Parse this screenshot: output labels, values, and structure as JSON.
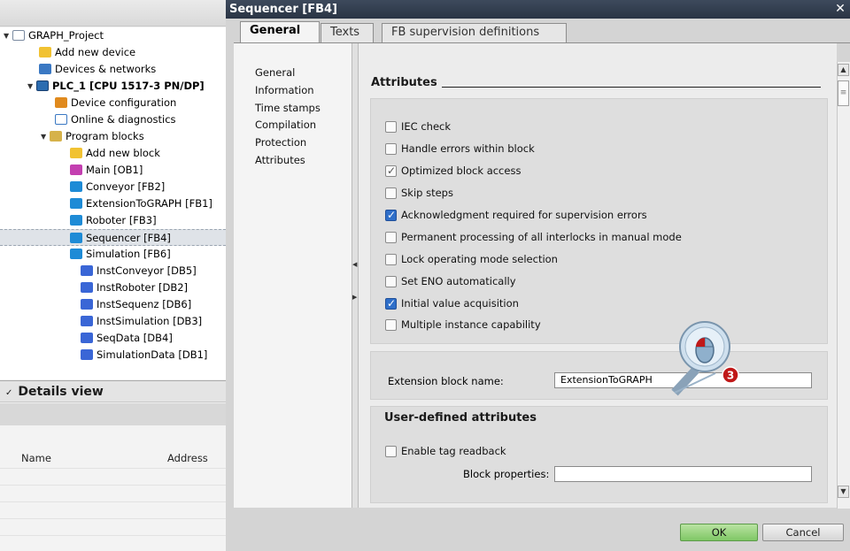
{
  "tree": {
    "items": [
      {
        "label": "GRAPH_Project",
        "icon": "project-icon"
      },
      {
        "label": "Add new device",
        "icon": "add-device-icon"
      },
      {
        "label": "Devices & networks",
        "icon": "network-icon"
      },
      {
        "label": "PLC_1 [CPU 1517-3 PN/DP]",
        "icon": "plc-icon"
      },
      {
        "label": "Device configuration",
        "icon": "device-config-icon"
      },
      {
        "label": "Online & diagnostics",
        "icon": "diagnostics-icon"
      },
      {
        "label": "Program blocks",
        "icon": "folder-icon"
      },
      {
        "label": "Add new block",
        "icon": "add-block-icon"
      },
      {
        "label": "Main [OB1]",
        "icon": "ob-icon"
      },
      {
        "label": "Conveyor [FB2]",
        "icon": "fb-icon"
      },
      {
        "label": "ExtensionToGRAPH [FB1]",
        "icon": "fb-icon"
      },
      {
        "label": "Roboter [FB3]",
        "icon": "fb-icon"
      },
      {
        "label": "Sequencer [FB4]",
        "icon": "fb-icon"
      },
      {
        "label": "Simulation [FB6]",
        "icon": "fb-icon"
      },
      {
        "label": "InstConveyor [DB5]",
        "icon": "db-icon"
      },
      {
        "label": "InstRoboter [DB2]",
        "icon": "db-icon"
      },
      {
        "label": "InstSequenz [DB6]",
        "icon": "db-icon"
      },
      {
        "label": "InstSimulation [DB3]",
        "icon": "db-icon"
      },
      {
        "label": "SeqData [DB4]",
        "icon": "db-icon"
      },
      {
        "label": "SimulationData [DB1]",
        "icon": "db-icon"
      }
    ]
  },
  "details": {
    "title": "Details view",
    "columns": [
      "Name",
      "Address"
    ]
  },
  "dialog": {
    "title": "Sequencer [FB4]",
    "close_icon": "close-icon",
    "tabs": [
      "General",
      "Texts",
      "FB supervision definitions"
    ],
    "active_tab": "General",
    "nav": [
      "General",
      "Information",
      "Time stamps",
      "Compilation",
      "Protection",
      "Attributes"
    ],
    "attributes": {
      "heading": "Attributes",
      "checkboxes": [
        {
          "label": "IEC check",
          "checked": false
        },
        {
          "label": "Handle errors within block",
          "checked": false
        },
        {
          "label": "Optimized block access",
          "checked": true,
          "disabled": true
        },
        {
          "label": "Skip steps",
          "checked": false
        },
        {
          "label": "Acknowledgment required for supervision errors",
          "checked": true
        },
        {
          "label": "Permanent processing of all interlocks in manual mode",
          "checked": false
        },
        {
          "label": "Lock operating mode selection",
          "checked": false
        },
        {
          "label": "Set ENO automatically",
          "checked": false
        },
        {
          "label": "Initial value acquisition",
          "checked": true
        },
        {
          "label": "Multiple instance capability",
          "checked": false
        }
      ]
    },
    "extension": {
      "label": "Extension block name:",
      "value": "ExtensionToGRAPH"
    },
    "user_defined": {
      "heading": "User-defined attributes",
      "enable_label": "Enable tag readback",
      "enable_checked": false,
      "block_props_label": "Block properties:",
      "block_props_value": ""
    },
    "ok_label": "OK",
    "cancel_label": "Cancel"
  },
  "callout": {
    "number": "3"
  },
  "colors": {
    "accent": "#2f6fc9",
    "ok_button": "#8fd077",
    "title_bar": "#2f3a4a"
  }
}
